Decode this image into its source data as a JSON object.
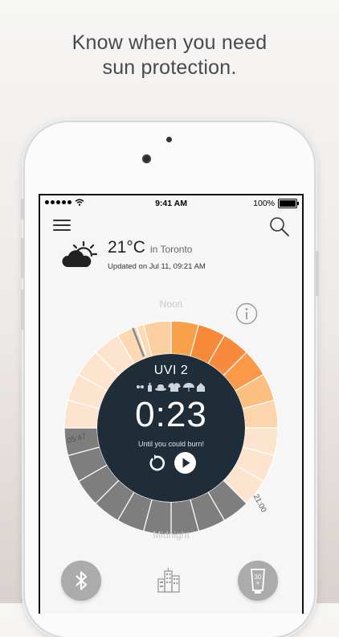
{
  "headline": {
    "line1": "Know when you need",
    "line2": "sun protection."
  },
  "status_bar": {
    "signal_icon": "signal-dots-icon",
    "wifi_icon": "wifi-icon",
    "time": "9:41 AM",
    "battery_percent": "100%",
    "battery_level": 1.0
  },
  "nav": {
    "menu_icon": "hamburger-menu-icon",
    "search_icon": "search-icon"
  },
  "weather": {
    "icon": "partly-cloudy-icon",
    "temperature": "21°C",
    "location": "in Toronto",
    "updated": "Updated on Jul 11, 09:21 AM"
  },
  "dial": {
    "noon_label": "Noon",
    "midnight_label": "Midnight",
    "sunrise_label": "05:47",
    "sunset_label": "21:00",
    "info_icon": "info-icon",
    "hourly_colors": [
      "#f8a04a",
      "#f7893a",
      "#f88a3e",
      "#fa9a49",
      "#fbbf7f",
      "#fcd5ad",
      "#fde4cf",
      "#fde4cf",
      "#fde4cf",
      "#7e7e7e",
      "#7e7e7e",
      "#7e7e7e",
      "#7e7e7e",
      "#7e7e7e",
      "#7e7e7e",
      "#7e7e7e",
      "#7e7e7e",
      "#7e7e7e",
      "#fde4cf",
      "#fde4cf",
      "#fde4cf",
      "#fde4cf",
      "#fcd9b3",
      "#fccfa2"
    ],
    "current_marker_color": "#8a8a8a",
    "center_color": "#1f2d38",
    "uvi": "UVI 2",
    "skin_icons": [
      "sunglasses-icon",
      "sunscreen-bottle-icon",
      "hat-icon",
      "shirt-icon",
      "umbrella-icon",
      "shade-house-icon"
    ],
    "countdown": "0:23",
    "countdown_caption": "Until you could burn!",
    "reset_icon": "reset-icon",
    "play_icon": "play-icon"
  },
  "bottom": {
    "bluetooth_icon": "bluetooth-icon",
    "city_icon": "city-buildings-icon",
    "sunscreen_icon": "sunscreen-tube-icon",
    "sunscreen_label": "30"
  }
}
